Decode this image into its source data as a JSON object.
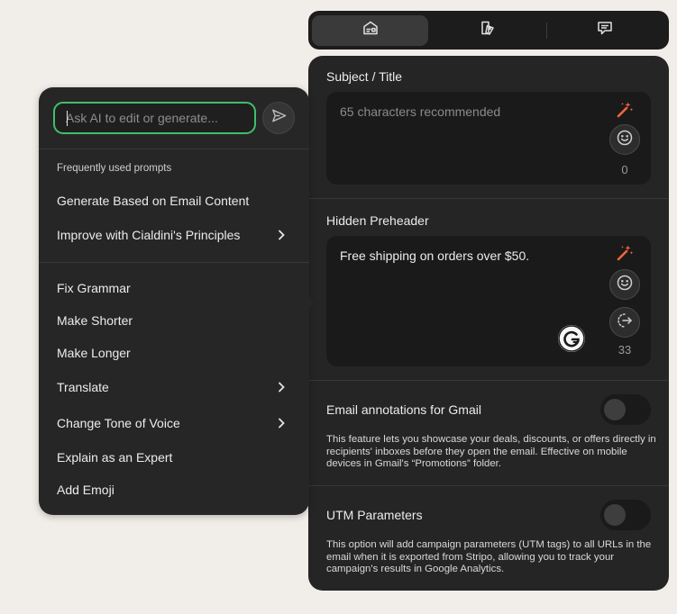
{
  "tabs": [
    {
      "icon": "email-preview-icon",
      "active": true
    },
    {
      "icon": "mobile-tag-icon",
      "active": false
    },
    {
      "icon": "comment-icon",
      "active": false
    }
  ],
  "subject": {
    "label": "Subject / Title",
    "placeholder": "65 characters recommended",
    "counter": "0"
  },
  "preheader": {
    "label": "Hidden Preheader",
    "value": "Free shipping on orders over $50.",
    "counter": "33"
  },
  "gmail_annotations": {
    "label": "Email annotations for Gmail",
    "enabled": false,
    "description": "This feature lets you showcase your deals, discounts, or offers directly in recipients' inboxes before they open the email. Effective on mobile devices in Gmail's “Promotions” folder."
  },
  "utm": {
    "label": "UTM Parameters",
    "enabled": false,
    "description": "This option will add campaign parameters (UTM tags) to all URLs in the email when it is exported from Stripo, allowing you to track your campaign's results in Google Analytics."
  },
  "ai_menu": {
    "input_placeholder": "Ask AI to edit or generate...",
    "heading": "Frequently used prompts",
    "frequent": [
      {
        "label": "Generate Based on Email Content",
        "submenu": false
      },
      {
        "label": "Improve with Cialdini's Principles",
        "submenu": true
      }
    ],
    "actions": [
      {
        "label": "Fix Grammar",
        "submenu": false
      },
      {
        "label": "Make Shorter",
        "submenu": false
      },
      {
        "label": "Make Longer",
        "submenu": false
      },
      {
        "label": "Translate",
        "submenu": true
      },
      {
        "label": "Change Tone of Voice",
        "submenu": true
      },
      {
        "label": "Explain as an Expert",
        "submenu": false
      },
      {
        "label": "Add Emoji",
        "submenu": false
      }
    ]
  },
  "colors": {
    "accent_green": "#3fbf6b",
    "magic_wand": "#f2653a",
    "panel_bg": "#252525",
    "page_bg": "#f1ede8"
  }
}
